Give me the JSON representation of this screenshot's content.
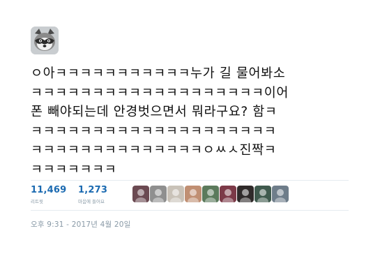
{
  "tweet": {
    "lines": [
      "ㅇ아ㅋㅋㅋㅋㅋㅋㅋㅋㅋㅋㅋ누가 길 물어봐소",
      "ㅋㅋㅋㅋㅋㅋㅋㅋㅋㅋㅋㅋㅋㅋㅋㅋㅋㅋㅋ이어",
      "폰 빼야되는데 안경벗으면서 뭐라구요? 함ㅋ",
      "ㅋㅋㅋㅋㅋㅋㅋㅋㅋㅋㅋㅋㅋㅋㅋㅋㅋㅋㅋㅋ",
      "ㅋㅋㅋㅋㅋㅋㅋㅋㅋㅋㅋㅋㅋㅋㅇㅆㅅ진짝ㅋ",
      "ㅋㅋㅋㅋㅋㅋㅋ"
    ]
  },
  "stats": {
    "retweets": {
      "count": "11,469",
      "label": "리트윗"
    },
    "likes": {
      "count": "1,273",
      "label": "마음에 들어요"
    }
  },
  "likers": [
    {
      "icon": "liker-avatar",
      "color": "#6b4a52"
    },
    {
      "icon": "liker-avatar",
      "color": "#8f8f8f"
    },
    {
      "icon": "liker-avatar",
      "color": "#c9c2b8"
    },
    {
      "icon": "liker-avatar",
      "color": "#c08f73"
    },
    {
      "icon": "liker-avatar",
      "color": "#5b7a5c"
    },
    {
      "icon": "liker-avatar",
      "color": "#7c3a48"
    },
    {
      "icon": "liker-avatar",
      "color": "#2f2a2a"
    },
    {
      "icon": "liker-avatar",
      "color": "#3f5a4e"
    },
    {
      "icon": "liker-avatar",
      "color": "#6e7d8a"
    }
  ],
  "timestamp": "오후 9:31 - 2017년 4월 20일",
  "colors": {
    "link_blue": "#1b6ab1",
    "muted_gray": "#8899a6",
    "divider": "#e6ecf0"
  }
}
